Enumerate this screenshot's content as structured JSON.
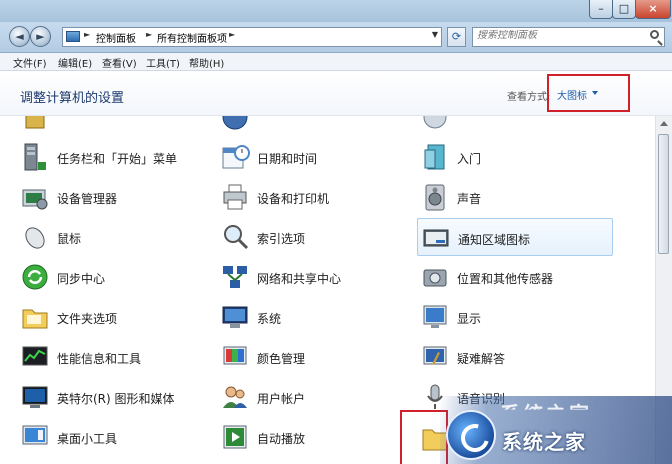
{
  "window": {
    "controls": {
      "minimize": "–",
      "maximize": "□",
      "close": "×"
    }
  },
  "navigation": {
    "back_glyph": "◄",
    "forward_glyph": "►",
    "breadcrumb": [
      "控制面板",
      "所有控制面板项"
    ],
    "separator": "►",
    "dropdown_glyph": "▼",
    "refresh_glyph": "⟳",
    "search_placeholder": "搜索控制面板"
  },
  "menu": [
    "文件(F)",
    "编辑(E)",
    "查看(V)",
    "工具(T)",
    "帮助(H)"
  ],
  "header": {
    "title": "调整计算机的设置",
    "view_by_label": "查看方式:",
    "view_by_value": "大图标"
  },
  "items": [
    {
      "label": "",
      "icon": "clipped-icon"
    },
    {
      "label": "",
      "icon": "clipped-icon"
    },
    {
      "label": "",
      "icon": "clipped-icon"
    },
    {
      "label": "任务栏和「开始」菜单",
      "icon": "taskbar-icon"
    },
    {
      "label": "日期和时间",
      "icon": "calendar-clock-icon"
    },
    {
      "label": "入门",
      "icon": "getting-started-icon"
    },
    {
      "label": "设备管理器",
      "icon": "device-manager-icon"
    },
    {
      "label": "设备和打印机",
      "icon": "printer-icon"
    },
    {
      "label": "声音",
      "icon": "speaker-icon"
    },
    {
      "label": "鼠标",
      "icon": "mouse-icon"
    },
    {
      "label": "索引选项",
      "icon": "index-search-icon"
    },
    {
      "label": "通知区域图标",
      "icon": "notification-area-icon"
    },
    {
      "label": "同步中心",
      "icon": "sync-center-icon"
    },
    {
      "label": "网络和共享中心",
      "icon": "network-icon"
    },
    {
      "label": "位置和其他传感器",
      "icon": "location-sensor-icon"
    },
    {
      "label": "文件夹选项",
      "icon": "folder-options-icon"
    },
    {
      "label": "系统",
      "icon": "system-icon"
    },
    {
      "label": "显示",
      "icon": "display-icon"
    },
    {
      "label": "性能信息和工具",
      "icon": "performance-icon"
    },
    {
      "label": "颜色管理",
      "icon": "color-management-icon"
    },
    {
      "label": "疑难解答",
      "icon": "troubleshooting-icon"
    },
    {
      "label": "英特尔(R) 图形和媒体",
      "icon": "intel-graphics-icon"
    },
    {
      "label": "用户帐户",
      "icon": "user-accounts-icon"
    },
    {
      "label": "语音识别",
      "icon": "microphone-icon"
    },
    {
      "label": "桌面小工具",
      "icon": "gadgets-icon"
    },
    {
      "label": "自动播放",
      "icon": "autoplay-icon"
    },
    {
      "label": "",
      "icon": "font-folder-icon"
    }
  ],
  "watermark": {
    "text": "系统之家"
  },
  "colors": {
    "accent": "#1f5ea8",
    "highlight": "#d0202a"
  }
}
